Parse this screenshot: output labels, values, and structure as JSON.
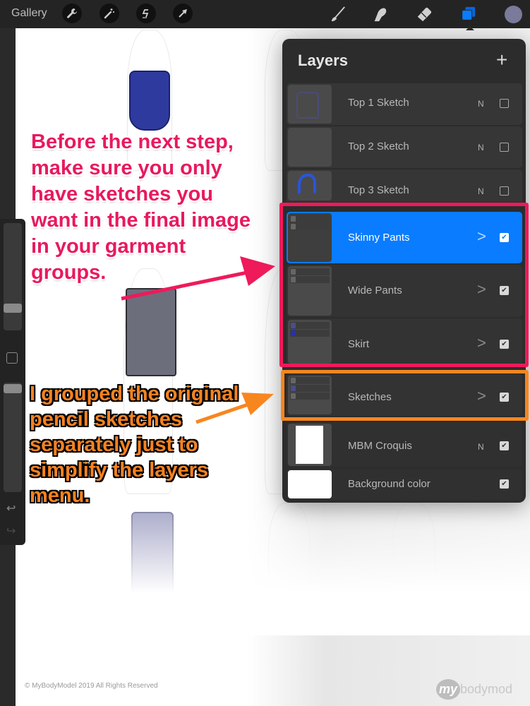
{
  "toolbar": {
    "gallery_label": "Gallery",
    "left_tools": [
      {
        "icon": "wrench-icon",
        "label": "Actions"
      },
      {
        "icon": "magic-wand-icon",
        "label": "Adjustments"
      },
      {
        "icon": "selection-icon",
        "label": "Selection"
      },
      {
        "icon": "transform-arrow-icon",
        "label": "Transform"
      }
    ],
    "right_tools": [
      {
        "icon": "brush-icon",
        "label": "Paint"
      },
      {
        "icon": "smudge-icon",
        "label": "Smudge"
      },
      {
        "icon": "eraser-icon",
        "label": "Erase"
      },
      {
        "icon": "layers-icon",
        "label": "Layers",
        "active": true
      }
    ],
    "current_color": "#7c7a9a",
    "active_color": "#0a7cff"
  },
  "sidebar": {
    "brush_size_level": 0.25,
    "opacity_level": 0.95,
    "undo_icon": "↩",
    "redo_icon": "↪"
  },
  "layers_panel": {
    "title": "Layers",
    "add_icon": "+",
    "layers": [
      {
        "name": "Top 1 Sketch",
        "mode": "N",
        "visible": false,
        "group": false,
        "selected": false
      },
      {
        "name": "Top 2 Sketch",
        "mode": "N",
        "visible": false,
        "group": false,
        "selected": false
      },
      {
        "name": "Top 3 Sketch",
        "mode": "N",
        "visible": false,
        "group": false,
        "selected": false
      },
      {
        "name": "Skinny Pants",
        "mode": ">",
        "visible": true,
        "group": true,
        "selected": true
      },
      {
        "name": "Wide Pants",
        "mode": ">",
        "visible": true,
        "group": true,
        "selected": false
      },
      {
        "name": "Skirt",
        "mode": ">",
        "visible": true,
        "group": true,
        "selected": false
      },
      {
        "name": "Sketches",
        "mode": ">",
        "visible": true,
        "group": true,
        "selected": false
      },
      {
        "name": "MBM Croquis",
        "mode": "N",
        "visible": true,
        "group": false,
        "selected": false
      },
      {
        "name": "Background color",
        "mode": "",
        "visible": true,
        "group": false,
        "selected": false
      }
    ]
  },
  "annotations": {
    "pink_note": "Before the next step, make sure you only have sketches you want in the final image in your garment groups.",
    "orange_note": "I grouped the original pencil sketches separately just to simplify the layers menu.",
    "pink_color": "#e8195f",
    "orange_color": "#f58220"
  },
  "footer": {
    "copyright": "© MyBodyModel 2019 All Rights Reserved",
    "logo_my": "my",
    "logo_rest": "bodymod"
  },
  "checkmark": "✔"
}
